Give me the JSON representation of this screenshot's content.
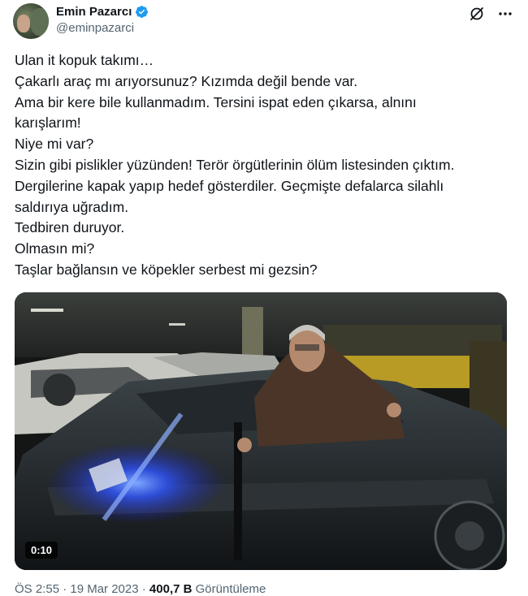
{
  "author": {
    "name": "Emin Pazarcı",
    "handle": "@eminpazarci"
  },
  "tweet": {
    "lines": [
      "Ulan it kopuk takımı…",
      "Çakarlı araç mı arıyorsunuz? Kızımda değil bende var.",
      "Ama bir kere bile kullanmadım. Tersini ispat eden çıkarsa, alnını",
      "karışlarım!",
      "Niye mi var?",
      "Sizin gibi pislikler yüzünden! Terör örgütlerinin ölüm listesinden çıktım.",
      "Dergilerine kapak yapıp hedef gösterdiler. Geçmişte defalarca silahlı",
      "saldırıya uğradım.",
      "Tedbiren duruyor.",
      "Olmasın mi?",
      "Taşlar bağlansın ve köpekler serbest mi gezsin?"
    ]
  },
  "video": {
    "duration": "0:10"
  },
  "meta": {
    "time": "ÖS 2:55 · 19 Mar 2023 ·",
    "views_count": "400,7 B",
    "views_label": "Görüntüleme"
  },
  "icons": {
    "verified": "verified-badge-icon",
    "grok": "grok-icon",
    "more": "more-options-icon"
  },
  "colors": {
    "verified": "#1d9bf0",
    "text": "#0f1419",
    "secondary": "#536471"
  }
}
